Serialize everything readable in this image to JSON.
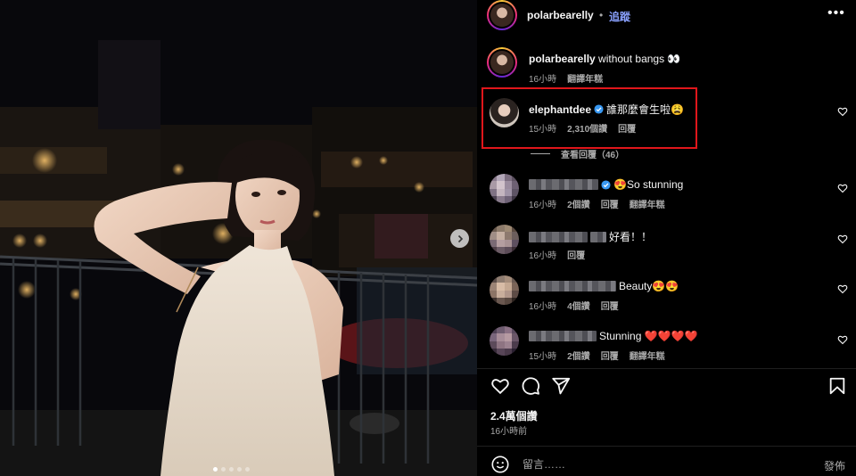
{
  "post": {
    "author": "polarbearelly",
    "follow_label": "追蹤",
    "more_icon": "more-horizontal-icon",
    "carousel_dots": 5,
    "carousel_active_index": 0
  },
  "caption": {
    "author": "polarbearelly",
    "text": "without bangs 👀",
    "time": "16小時",
    "translate": "翻譯年糕"
  },
  "comments": [
    {
      "username": "elephantdee",
      "verified": true,
      "text": "誰那麼會生啦😩",
      "time": "15小時",
      "likes": "2,310個讚",
      "reply": "回覆",
      "translate": "",
      "highlighted": true,
      "blurred": false,
      "view_replies": "查看回覆（46）"
    },
    {
      "username": "",
      "verified": true,
      "text": "😍So stunning",
      "time": "16小時",
      "likes": "2個讚",
      "reply": "回覆",
      "translate": "翻譯年糕",
      "blurred": true
    },
    {
      "username": "",
      "verified": false,
      "text": "好看！！",
      "time": "16小時",
      "likes": "",
      "reply": "回覆",
      "translate": "",
      "blurred": true
    },
    {
      "username": "",
      "verified": false,
      "text": "Beauty😍😍",
      "time": "16小時",
      "likes": "4個讚",
      "reply": "回覆",
      "translate": "",
      "blurred": true
    },
    {
      "username": "",
      "verified": false,
      "text": "Stunning ❤️❤️❤️❤️",
      "time": "15小時",
      "likes": "2個讚",
      "reply": "回覆",
      "translate": "翻譯年糕",
      "blurred": true
    }
  ],
  "actions": {
    "like_icon": "heart-icon",
    "comment_icon": "comment-icon",
    "share_icon": "share-icon",
    "save_icon": "bookmark-icon"
  },
  "likes_total": "2.4萬個讚",
  "post_time": "16小時前",
  "composer": {
    "placeholder": "留言……",
    "post_label": "發佈"
  },
  "colors": {
    "background": "#000000",
    "text": "#f5f5f5",
    "secondary_text": "#a8a8a8",
    "follow_link": "#8aa1ff",
    "highlight_box": "#e0161b",
    "verified_badge": "#3897f0"
  }
}
